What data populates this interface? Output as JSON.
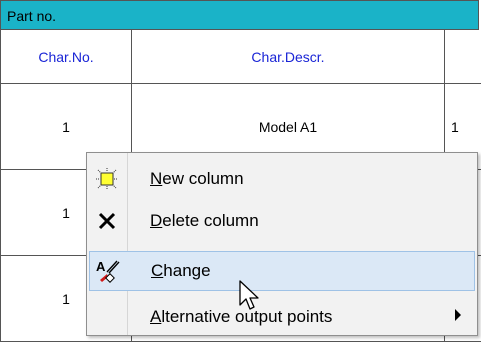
{
  "table": {
    "title": "Part no.",
    "headers": {
      "char_no": "Char.No.",
      "char_descr": "Char.Descr."
    },
    "rows": [
      {
        "char_no": "1",
        "char_descr": "Model A1",
        "extra": "1"
      },
      {
        "char_no": "1",
        "char_descr": "",
        "extra": ""
      },
      {
        "char_no": "1",
        "char_descr": "",
        "extra": ""
      }
    ],
    "colors": {
      "title_bg": "#1ab3c8",
      "header_text": "#1a25d6"
    }
  },
  "context_menu": {
    "items": [
      {
        "icon": "new-column-icon",
        "mnemonic": "N",
        "rest": "ew column",
        "submenu": false
      },
      {
        "icon": "delete-icon",
        "mnemonic": "D",
        "rest": "elete column",
        "submenu": false
      },
      {
        "icon": "change-icon",
        "mnemonic": "C",
        "rest": "hange",
        "submenu": false,
        "highlighted": true
      },
      {
        "icon": "",
        "mnemonic": "A",
        "rest": "lternative output points",
        "submenu": true
      }
    ],
    "colors": {
      "background": "#f2f2f2",
      "highlight": "#dbe8f6"
    }
  }
}
